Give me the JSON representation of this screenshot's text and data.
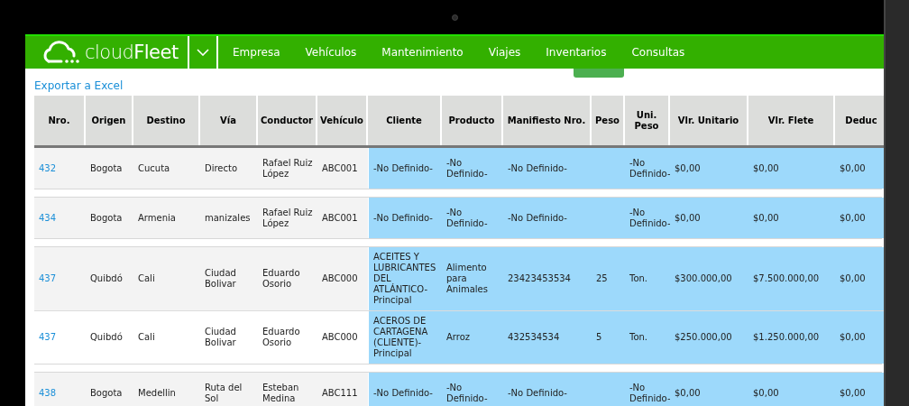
{
  "nav": {
    "logo": "cloud**Fleet**",
    "items": [
      "Empresa",
      "Vehículos",
      "Mantenimiento",
      "Viajes",
      "Inventarios",
      "Consultas"
    ]
  },
  "export_link": "Exportar a Excel",
  "table": {
    "columns": [
      "Nro.",
      "Origen",
      "Destino",
      "Vía",
      "Conductor",
      "Vehículo",
      "Cliente",
      "Producto",
      "Manifiesto Nro.",
      "Peso",
      "Uni. Peso",
      "Vlr. Unitario",
      "Vlr. Flete",
      "Deduc"
    ],
    "groups": [
      {
        "rows": [
          [
            "432",
            "Bogota",
            "Cucuta",
            "Directo",
            "Rafael Ruiz López",
            "ABC001",
            "-No Definido-",
            "-No Definido-",
            "-No Definido-",
            "",
            "-No Definido-",
            "$0,00",
            "$0,00",
            "$0,00"
          ]
        ]
      },
      {
        "rows": [
          [
            "434",
            "Bogota",
            "Armenia",
            "manizales",
            "Rafael Ruiz López",
            "ABC001",
            "-No Definido-",
            "-No Definido-",
            "-No Definido-",
            "",
            "-No Definido-",
            "$0,00",
            "$0,00",
            "$0,00"
          ]
        ]
      },
      {
        "rows": [
          [
            "437",
            "Quibdó",
            "Cali",
            "Ciudad Bolivar",
            "Eduardo Osorio",
            "ABC000",
            "ACEITES Y LUBRICANTES DEL ATLÁNTICO-Principal",
            "Alimento para Animales",
            "23423453534",
            "25",
            "Ton.",
            "$300.000,00",
            "$7.500.000,00",
            "$0,00"
          ],
          [
            "437",
            "Quibdó",
            "Cali",
            "Ciudad Bolivar",
            "Eduardo Osorio",
            "ABC000",
            "ACEROS DE CARTAGENA (CLIENTE)-Principal",
            "Arroz",
            "432534534",
            "5",
            "Ton.",
            "$250.000,00",
            "$1.250.000,00",
            "$0,00"
          ]
        ]
      },
      {
        "rows": [
          [
            "438",
            "Bogota",
            "Medellin",
            "Ruta del Sol",
            "Esteban Medina",
            "ABC111",
            "-No Definido-",
            "-No Definido-",
            "-No Definido-",
            "",
            "-No Definido-",
            "$0,00",
            "$0,00",
            "$0,00"
          ]
        ]
      }
    ]
  }
}
